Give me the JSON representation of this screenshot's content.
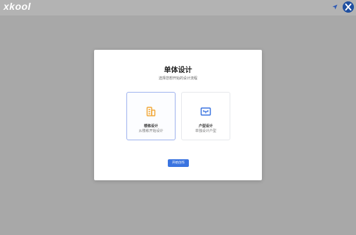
{
  "app": {
    "logo_text": "xkool"
  },
  "modal": {
    "title": "单体设计",
    "subtitle": "选择您想开始的设计流程",
    "cards": [
      {
        "title": "楼栋设计",
        "description": "从楼栋开始设计",
        "icon": "building-icon"
      },
      {
        "title": "户型设计",
        "description": "单独设计户型",
        "icon": "floorplan-icon"
      }
    ],
    "start_label": "开始创作"
  },
  "colors": {
    "accent": "#3a74e0",
    "building_icon": "#f2a93b",
    "floorplan_icon": "#3a74e0",
    "avatar": "#1f4fa0"
  }
}
